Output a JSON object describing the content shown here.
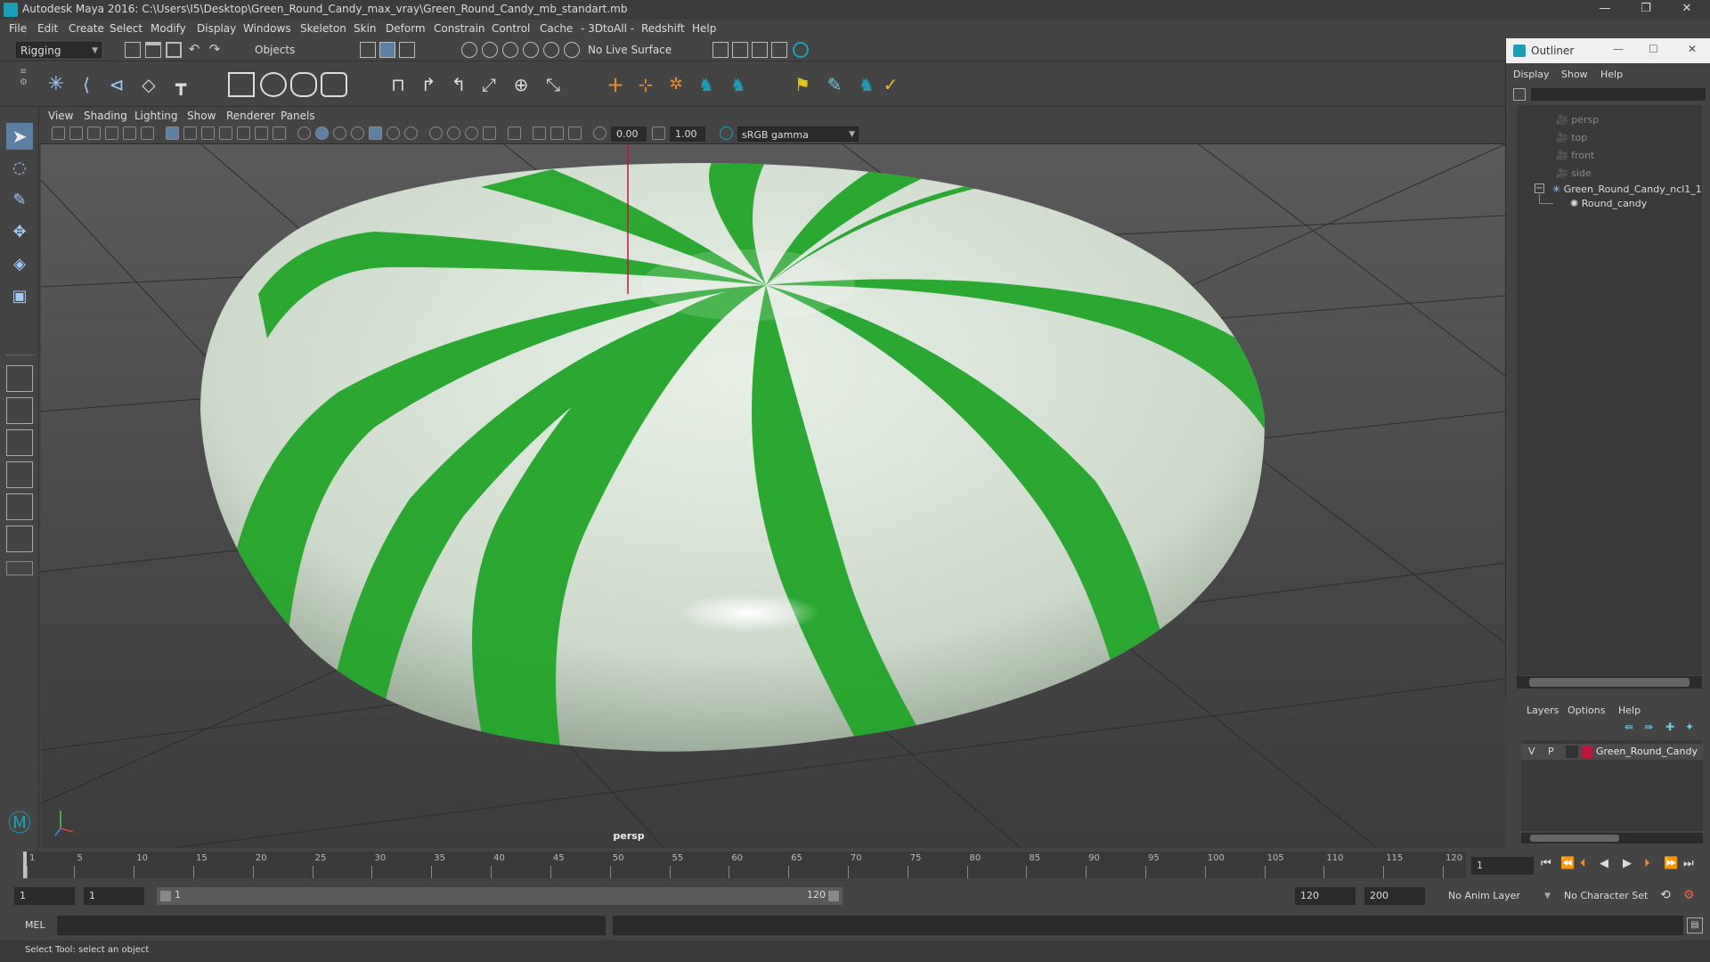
{
  "window": {
    "title": "Autodesk Maya 2016: C:\\Users\\I5\\Desktop\\Green_Round_Candy_max_vray\\Green_Round_Candy_mb_standart.mb",
    "minimize": "—",
    "restore": "❐",
    "close": "✕"
  },
  "menubar": [
    "File",
    "Edit",
    "Create",
    "Select",
    "Modify",
    "Display",
    "Windows",
    "Skeleton",
    "Skin",
    "Deform",
    "Constrain",
    "Control",
    "Cache",
    "- 3DtoAll -",
    "Redshift",
    "Help"
  ],
  "statusline": {
    "mode": "Rigging",
    "select_mode": "Objects",
    "live_surface": "No Live Surface"
  },
  "panel_menu": [
    "View",
    "Shading",
    "Lighting",
    "Show",
    "Renderer",
    "Panels"
  ],
  "panel_toolbar": {
    "exposure": "0.00",
    "gamma": "1.00",
    "color_space": "sRGB gamma"
  },
  "viewport": {
    "camera_label": "persp"
  },
  "outliner": {
    "title": "Outliner",
    "menu": [
      "Display",
      "Show",
      "Help"
    ],
    "nodes": [
      {
        "label": "persp",
        "type": "camera"
      },
      {
        "label": "top",
        "type": "camera"
      },
      {
        "label": "front",
        "type": "camera"
      },
      {
        "label": "side",
        "type": "camera"
      },
      {
        "label": "Green_Round_Candy_ncl1_1",
        "type": "group"
      },
      {
        "label": "Round_candy",
        "type": "mesh"
      }
    ],
    "collapse_symbol": "−"
  },
  "layers": {
    "menu": [
      "Layers",
      "Options",
      "Help"
    ],
    "row": {
      "visible": "V",
      "playback": "P",
      "name": "Green_Round_Candy",
      "color": "#c0143c"
    }
  },
  "timeline": {
    "ticks": [
      "1",
      "5",
      "10",
      "15",
      "20",
      "25",
      "30",
      "35",
      "40",
      "45",
      "50",
      "55",
      "60",
      "65",
      "70",
      "75",
      "80",
      "85",
      "90",
      "95",
      "100",
      "105",
      "110",
      "115",
      "120"
    ],
    "current_frame": "1"
  },
  "range": {
    "start": "1",
    "playback_start": "1",
    "slider_start": "1",
    "slider_end": "120",
    "playback_end": "120",
    "end": "200",
    "anim_layer": "No Anim Layer",
    "character_set": "No Character Set"
  },
  "cmdline": {
    "lang": "MEL"
  },
  "helpline": {
    "text": "Select Tool: select an object"
  },
  "colors": {
    "candy_green": "#22a52a",
    "candy_white": "#dde6dc",
    "accent": "#19a0b6"
  }
}
